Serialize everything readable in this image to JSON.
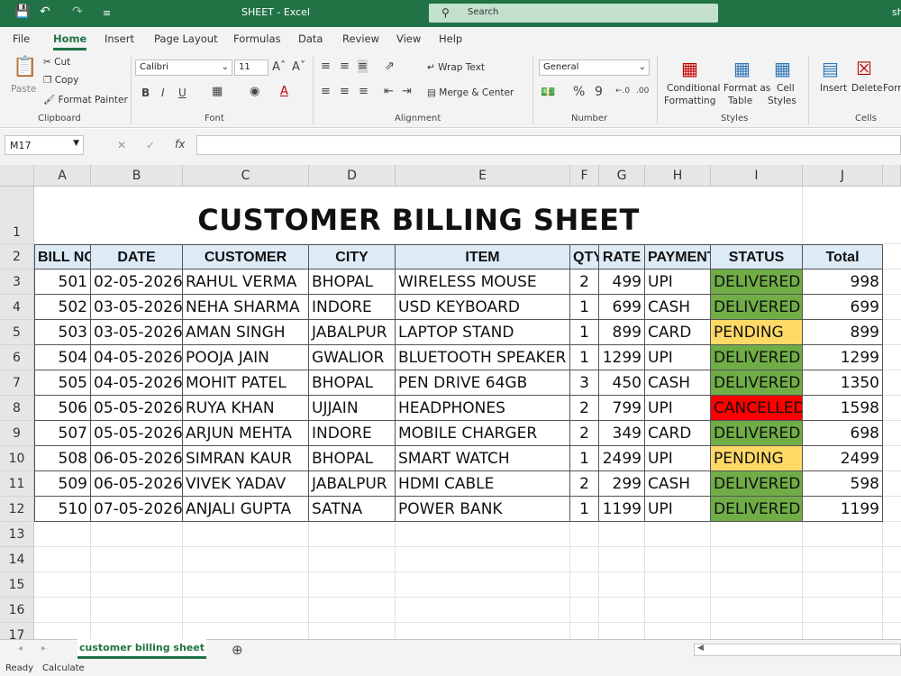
{
  "titlebar": {
    "title": "SHEET  -  Excel",
    "search_label": "Search",
    "user": "sh",
    "qa_save": "💾",
    "qa_undo": "↶",
    "qa_redo": "↷",
    "qa_more": "≡"
  },
  "tabs": [
    "File",
    "Home",
    "Insert",
    "Page Layout",
    "Formulas",
    "Data",
    "Review",
    "View",
    "Help"
  ],
  "ribbon": {
    "paste": "Paste",
    "cut": "Cut",
    "copy": "Copy",
    "format_painter": "Format Painter",
    "clipboard": "Clipboard",
    "font_name": "Calibri",
    "font_size": "11",
    "font": "Font",
    "wrap_text": "Wrap Text",
    "merge_center": "Merge & Center",
    "alignment": "Alignment",
    "number_format": "General",
    "number": "Number",
    "conditional_formatting_1": "Conditional",
    "conditional_formatting_2": "Formatting",
    "format_as_table_1": "Format as",
    "format_as_table_2": "Table",
    "cell_styles_1": "Cell",
    "cell_styles_2": "Styles",
    "styles": "Styles",
    "insert": "Insert",
    "delete": "Delete",
    "format": "Form",
    "cells": "Cells",
    "bold": "B",
    "italic": "I",
    "underline": "U",
    "font_color": "A",
    "percent": "%",
    "comma": "9"
  },
  "formula_bar": {
    "name_box": "M17",
    "fx": "fx",
    "cancel": "✕",
    "enter": "✓",
    "content": ""
  },
  "columns": [
    "A",
    "B",
    "C",
    "D",
    "E",
    "F",
    "G",
    "H",
    "I",
    "J"
  ],
  "rows": [
    "1",
    "2",
    "3",
    "4",
    "5",
    "6",
    "7",
    "8",
    "9",
    "10",
    "11",
    "12",
    "13",
    "14",
    "15",
    "16",
    "17"
  ],
  "sheet": {
    "title": "CUSTOMER BILLING SHEET",
    "headers": [
      "BILL NO",
      "DATE",
      "CUSTOMER",
      "CITY",
      "ITEM",
      "QTY",
      "RATE",
      "PAYMENT",
      "STATUS",
      "Total"
    ],
    "records": [
      [
        "501",
        "02-05-2026",
        "RAHUL VERMA",
        "BHOPAL",
        "WIRELESS MOUSE",
        "2",
        "499",
        "UPI",
        "DELIVERED",
        "998"
      ],
      [
        "502",
        "03-05-2026",
        "NEHA SHARMA",
        "INDORE",
        "USD KEYBOARD",
        "1",
        "699",
        "CASH",
        "DELIVERED",
        "699"
      ],
      [
        "503",
        "03-05-2026",
        "AMAN SINGH",
        "JABALPUR",
        "LAPTOP STAND",
        "1",
        "899",
        "CARD",
        "PENDING",
        "899"
      ],
      [
        "504",
        "04-05-2026",
        "POOJA JAIN",
        "GWALIOR",
        "BLUETOOTH SPEAKER",
        "1",
        "1299",
        "UPI",
        "DELIVERED",
        "1299"
      ],
      [
        "505",
        "04-05-2026",
        "MOHIT PATEL",
        "BHOPAL",
        "PEN DRIVE 64GB",
        "3",
        "450",
        "CASH",
        "DELIVERED",
        "1350"
      ],
      [
        "506",
        "05-05-2026",
        "RUYA KHAN",
        "UJJAIN",
        "HEADPHONES",
        "2",
        "799",
        "UPI",
        "CANCELLED",
        "1598"
      ],
      [
        "507",
        "05-05-2026",
        "ARJUN MEHTA",
        "INDORE",
        "MOBILE CHARGER",
        "2",
        "349",
        "CARD",
        "DELIVERED",
        "698"
      ],
      [
        "508",
        "06-05-2026",
        "SIMRAN KAUR",
        "BHOPAL",
        "SMART WATCH",
        "1",
        "2499",
        "UPI",
        "PENDING",
        "2499"
      ],
      [
        "509",
        "06-05-2026",
        "VIVEK YADAV",
        "JABALPUR",
        "HDMI CABLE",
        "2",
        "299",
        "CASH",
        "DELIVERED",
        "598"
      ],
      [
        "510",
        "07-05-2026",
        "ANJALI GUPTA",
        "SATNA",
        "POWER BANK",
        "1",
        "1199",
        "UPI",
        "DELIVERED",
        "1199"
      ]
    ],
    "status_colors": {
      "DELIVERED": "#70ad47",
      "PENDING": "#ffd966",
      "CANCELLED": "#ff0000"
    },
    "header_fill": "#ddebf7"
  },
  "sheet_tabs": {
    "active": "customer billing sheet",
    "add": "⊕",
    "prev": "◂",
    "next": "▸"
  },
  "status": {
    "ready": "Ready",
    "calculate": "Calculate"
  },
  "accent": "#217346"
}
